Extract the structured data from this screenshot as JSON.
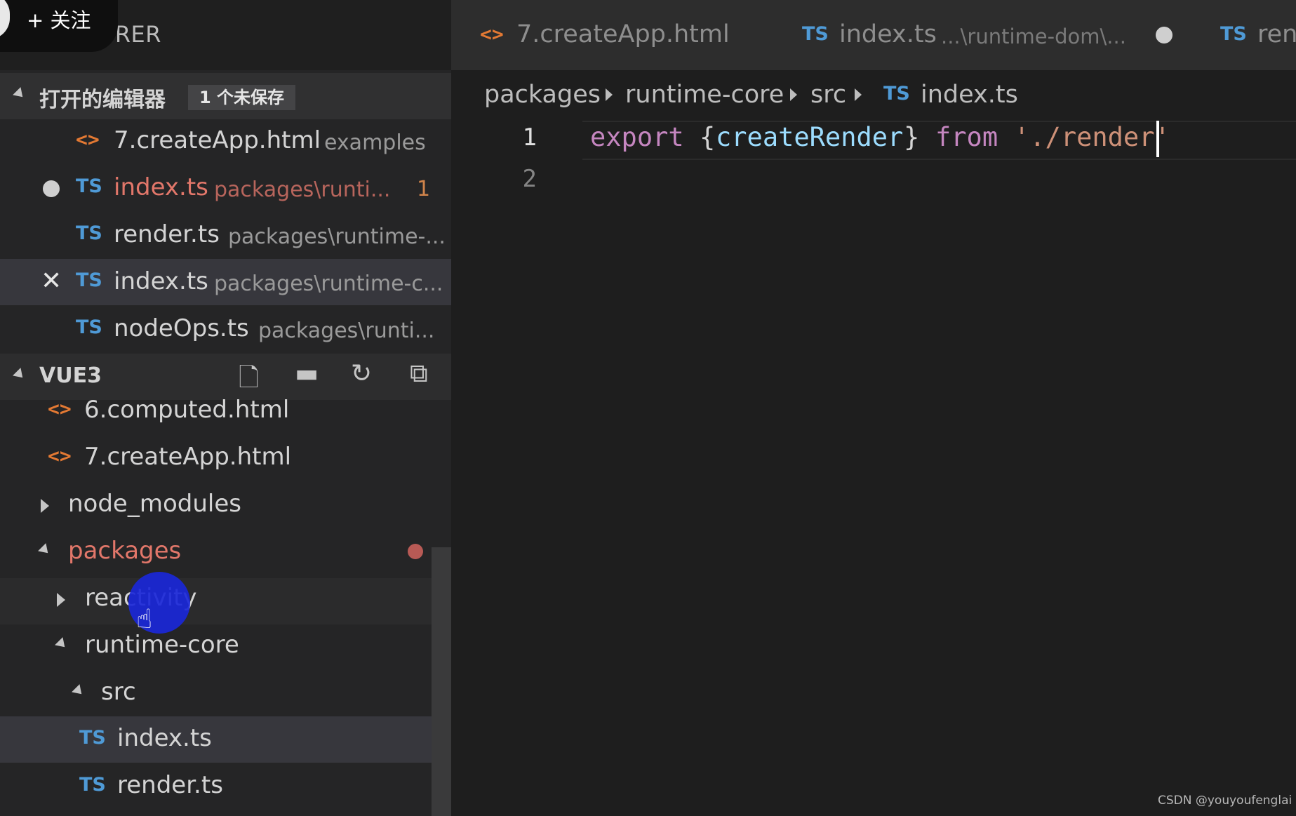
{
  "overlay": {
    "follow_label": "+ 关注"
  },
  "sidebar": {
    "title": "EXPLORER",
    "open_editors": {
      "title": "打开的编辑器",
      "badge": "1 个未保存",
      "items": [
        {
          "name": "7.createApp.html",
          "path": "examples",
          "icon": "<>",
          "modified": false
        },
        {
          "name": "index.ts",
          "path": "packages\\runti...",
          "icon": "TS",
          "modified": true,
          "count": "1"
        },
        {
          "name": "render.ts",
          "path": "packages\\runtime-...",
          "icon": "TS",
          "modified": false
        },
        {
          "name": "index.ts",
          "path": "packages\\runtime-c...",
          "icon": "TS",
          "modified": false,
          "selected": true
        },
        {
          "name": "nodeOps.ts",
          "path": "packages\\runti...",
          "icon": "TS",
          "modified": false
        }
      ]
    },
    "workspace": {
      "title": "VUE3",
      "tree": [
        {
          "name": "6.computed.html",
          "icon": "<>"
        },
        {
          "name": "7.createApp.html",
          "icon": "<>"
        },
        {
          "name": "node_modules",
          "expanded": false
        },
        {
          "name": "packages",
          "expanded": true,
          "modified": true
        },
        {
          "name": "reactivity",
          "expanded": false
        },
        {
          "name": "runtime-core",
          "expanded": true
        },
        {
          "name": "src",
          "expanded": true
        },
        {
          "name": "index.ts",
          "icon": "TS",
          "selected": true
        },
        {
          "name": "render.ts",
          "icon": "TS"
        }
      ]
    }
  },
  "editor": {
    "tabs": [
      {
        "icon": "<>",
        "label": "7.createApp.html",
        "desc": ""
      },
      {
        "icon": "TS",
        "label": "index.ts",
        "desc": "...\\runtime-dom\\..."
      },
      {
        "icon": "TS",
        "label": "ren",
        "desc": ""
      }
    ],
    "breadcrumb": [
      "packages",
      "runtime-core",
      "src",
      "index.ts"
    ],
    "breadcrumb_file_icon": "TS",
    "line_numbers": [
      "1",
      "2"
    ],
    "code_tokens": {
      "kw_export": "export",
      "brace_open": "{",
      "ident": "createRender",
      "brace_close": "}",
      "kw_from": "from",
      "string": "'./render'"
    }
  },
  "watermark": "CSDN @youyoufenglai",
  "colors": {
    "accent_blue": "#4f9ad6",
    "html_orange": "#e37933",
    "modified_red": "#e2776a",
    "keyword": "#c586c0",
    "identifier": "#9cdcfe",
    "string": "#ce9178"
  }
}
